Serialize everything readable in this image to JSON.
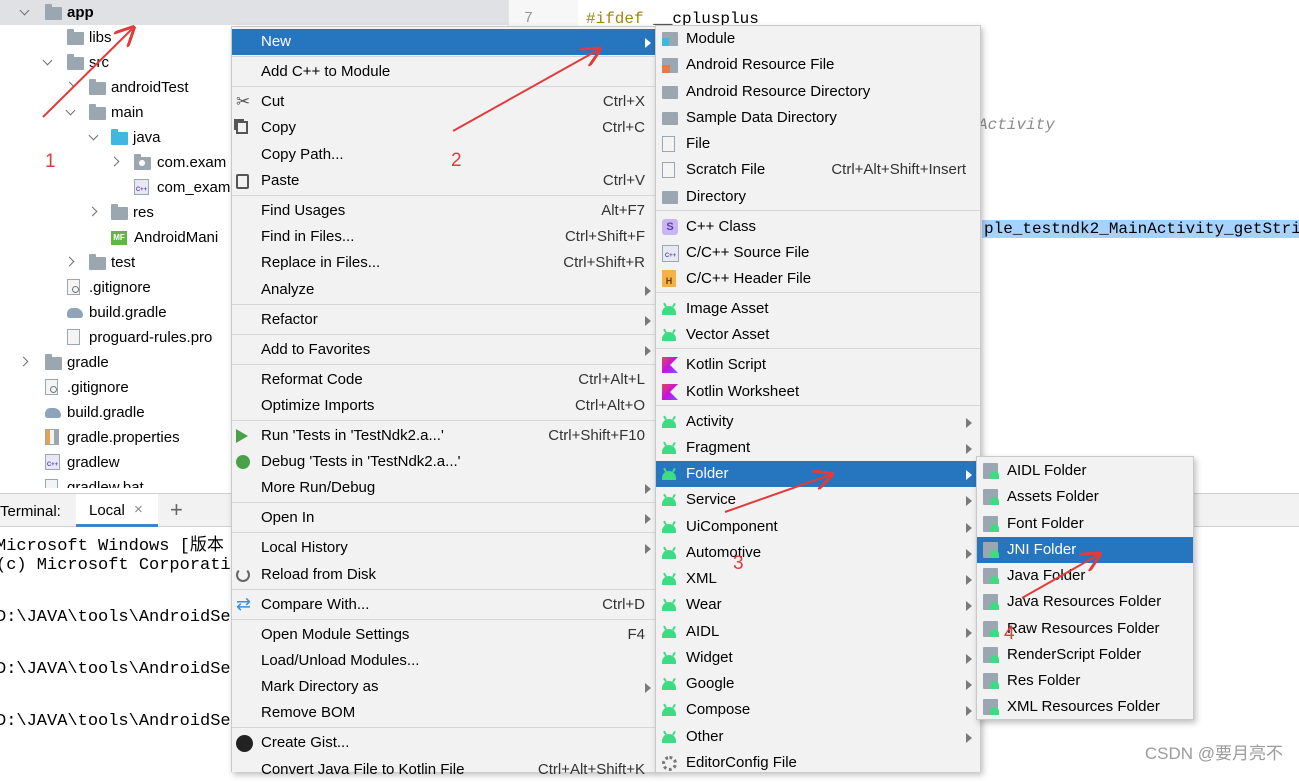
{
  "tree": {
    "items": [
      {
        "label": "app",
        "icon": "module-folder-icon",
        "bold": true,
        "expanded": true
      },
      {
        "label": "libs",
        "icon": "folder-icon"
      },
      {
        "label": "src",
        "icon": "folder-icon",
        "expanded": true
      },
      {
        "label": "androidTest",
        "icon": "folder-icon",
        "expanded": false
      },
      {
        "label": "main",
        "icon": "folder-icon",
        "expanded": true
      },
      {
        "label": "java",
        "icon": "source-folder-icon",
        "expanded": true
      },
      {
        "label": "com.exam",
        "icon": "package-icon",
        "expanded": false
      },
      {
        "label": "com_exam",
        "icon": "cpp-file-icon"
      },
      {
        "label": "res",
        "icon": "resource-folder-icon",
        "expanded": false
      },
      {
        "label": "AndroidMani",
        "icon": "manifest-icon"
      },
      {
        "label": "test",
        "icon": "folder-icon",
        "expanded": false
      },
      {
        "label": ".gitignore",
        "icon": "gitignore-icon"
      },
      {
        "label": "build.gradle",
        "icon": "gradle-icon"
      },
      {
        "label": "proguard-rules.pro",
        "icon": "file-icon"
      },
      {
        "label": "gradle",
        "icon": "folder-icon",
        "expanded": false
      },
      {
        "label": ".gitignore",
        "icon": "gitignore-icon"
      },
      {
        "label": "build.gradle",
        "icon": "gradle-icon"
      },
      {
        "label": "gradle.properties",
        "icon": "properties-icon"
      },
      {
        "label": "gradlew",
        "icon": "cpp-file-icon"
      },
      {
        "label": "gradlew.bat",
        "icon": "file-icon"
      }
    ]
  },
  "editor": {
    "line_number": "7",
    "directive": "#ifdef",
    "directive_arg": "__cplusplus",
    "activity_fragment": "Activity",
    "highlighted": "ple_testndk2_MainActivity_getStri"
  },
  "terminal": {
    "title": "Terminal:",
    "tab": "Local",
    "close": "×",
    "add": "+",
    "lines": [
      "Microsoft Windows [版本",
      "(c) Microsoft Corporatio",
      "D:\\JAVA\\tools\\AndroidSer",
      "D:\\JAVA\\tools\\AndroidSer",
      "D:\\JAVA\\tools\\AndroidSer"
    ]
  },
  "context_menu": {
    "items": [
      {
        "label": "New",
        "arrow": true,
        "active": true
      },
      {
        "label": "Add C++ to Module"
      },
      {
        "label": "Cut",
        "shortcut": "Ctrl+X",
        "icon": "scissors-icon"
      },
      {
        "label": "Copy",
        "shortcut": "Ctrl+C",
        "icon": "copy-icon"
      },
      {
        "label": "Copy Path..."
      },
      {
        "label": "Paste",
        "shortcut": "Ctrl+V",
        "icon": "paste-icon"
      },
      {
        "label": "Find Usages",
        "shortcut": "Alt+F7"
      },
      {
        "label": "Find in Files...",
        "shortcut": "Ctrl+Shift+F"
      },
      {
        "label": "Replace in Files...",
        "shortcut": "Ctrl+Shift+R"
      },
      {
        "label": "Analyze",
        "arrow": true
      },
      {
        "label": "Refactor",
        "arrow": true
      },
      {
        "label": "Add to Favorites",
        "arrow": true
      },
      {
        "label": "Reformat Code",
        "shortcut": "Ctrl+Alt+L"
      },
      {
        "label": "Optimize Imports",
        "shortcut": "Ctrl+Alt+O"
      },
      {
        "label": "Run 'Tests in 'TestNdk2.a...'",
        "shortcut": "Ctrl+Shift+F10",
        "icon": "run-icon"
      },
      {
        "label": "Debug 'Tests in 'TestNdk2.a...'",
        "icon": "debug-icon"
      },
      {
        "label": "More Run/Debug",
        "arrow": true
      },
      {
        "label": "Open In",
        "arrow": true
      },
      {
        "label": "Local History",
        "arrow": true
      },
      {
        "label": "Reload from Disk",
        "icon": "reload-icon"
      },
      {
        "label": "Compare With...",
        "shortcut": "Ctrl+D",
        "icon": "compare-icon"
      },
      {
        "label": "Open Module Settings",
        "shortcut": "F4"
      },
      {
        "label": "Load/Unload Modules..."
      },
      {
        "label": "Mark Directory as",
        "arrow": true
      },
      {
        "label": "Remove BOM"
      },
      {
        "label": "Create Gist...",
        "icon": "github-icon"
      },
      {
        "label": "Convert Java File to Kotlin File",
        "shortcut": "Ctrl+Alt+Shift+K"
      }
    ]
  },
  "new_menu": {
    "items": [
      {
        "label": "Module",
        "icon": "module-icon"
      },
      {
        "label": "Android Resource File",
        "icon": "resource-file-icon"
      },
      {
        "label": "Android Resource Directory",
        "icon": "folder-icon"
      },
      {
        "label": "Sample Data Directory",
        "icon": "folder-icon"
      },
      {
        "label": "File",
        "icon": "file-icon"
      },
      {
        "label": "Scratch File",
        "shortcut": "Ctrl+Alt+Shift+Insert",
        "icon": "scratch-file-icon"
      },
      {
        "label": "Directory",
        "icon": "folder-icon"
      },
      {
        "label": "C++ Class",
        "icon": "cpp-class-icon"
      },
      {
        "label": "C/C++ Source File",
        "icon": "cpp-source-icon"
      },
      {
        "label": "C/C++ Header File",
        "icon": "cpp-header-icon"
      },
      {
        "label": "Image Asset",
        "icon": "android-icon"
      },
      {
        "label": "Vector Asset",
        "icon": "android-icon"
      },
      {
        "label": "Kotlin Script",
        "icon": "kotlin-icon"
      },
      {
        "label": "Kotlin Worksheet",
        "icon": "kotlin-icon"
      },
      {
        "label": "Activity",
        "icon": "android-icon",
        "arrow": true
      },
      {
        "label": "Fragment",
        "icon": "android-icon",
        "arrow": true
      },
      {
        "label": "Folder",
        "icon": "android-icon",
        "arrow": true,
        "active": true
      },
      {
        "label": "Service",
        "icon": "android-icon",
        "arrow": true
      },
      {
        "label": "UiComponent",
        "icon": "android-icon",
        "arrow": true
      },
      {
        "label": "Automotive",
        "icon": "android-icon",
        "arrow": true
      },
      {
        "label": "XML",
        "icon": "android-icon",
        "arrow": true
      },
      {
        "label": "Wear",
        "icon": "android-icon",
        "arrow": true
      },
      {
        "label": "AIDL",
        "icon": "android-icon",
        "arrow": true
      },
      {
        "label": "Widget",
        "icon": "android-icon",
        "arrow": true
      },
      {
        "label": "Google",
        "icon": "android-icon",
        "arrow": true
      },
      {
        "label": "Compose",
        "icon": "android-icon",
        "arrow": true
      },
      {
        "label": "Other",
        "icon": "android-icon",
        "arrow": true
      },
      {
        "label": "EditorConfig File",
        "icon": "gear-icon"
      }
    ]
  },
  "folder_menu": {
    "items": [
      {
        "label": "AIDL Folder"
      },
      {
        "label": "Assets Folder"
      },
      {
        "label": "Font Folder"
      },
      {
        "label": "JNI Folder",
        "active": true
      },
      {
        "label": "Java Folder"
      },
      {
        "label": "Java Resources Folder"
      },
      {
        "label": "Raw Resources Folder"
      },
      {
        "label": "RenderScript Folder"
      },
      {
        "label": "Res Folder"
      },
      {
        "label": "XML Resources Folder"
      }
    ]
  },
  "annotations": {
    "step1": "1",
    "step2": "2",
    "step3": "3",
    "step4": "4",
    "color": "#e23b3b"
  },
  "watermark": "CSDN @要月亮不",
  "colors": {
    "menu_bg": "#f2f2f2",
    "selection": "#2675bf",
    "tree_selection": "#dfe1e5"
  }
}
